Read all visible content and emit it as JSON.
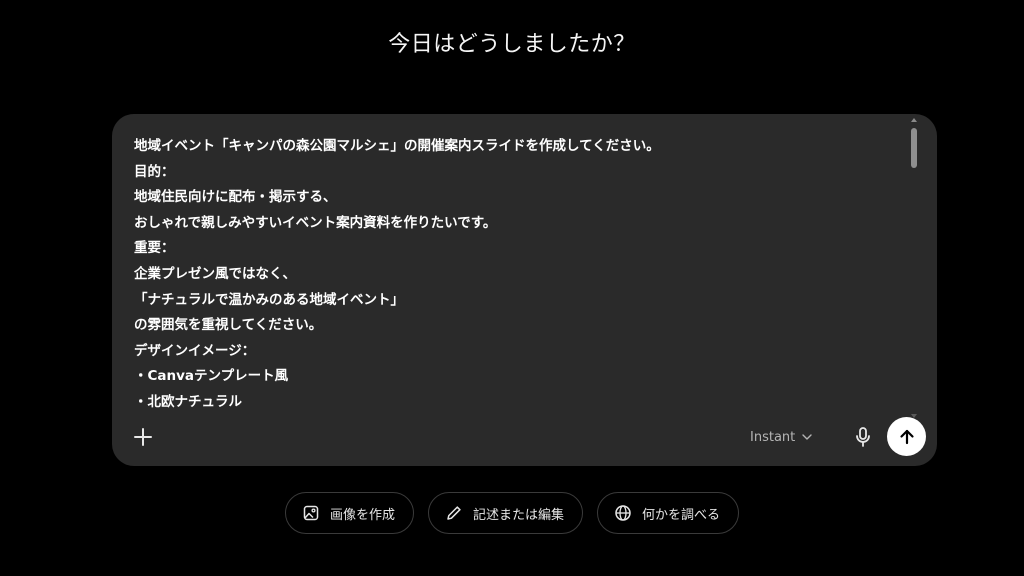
{
  "heading": "今日はどうしましたか？",
  "composer": {
    "prompt_lines": [
      "地域イベント「キャンパの森公園マルシェ」の開催案内スライドを作成してください。",
      "目的：",
      "地域住民向けに配布・掲示する、",
      "おしゃれで親しみやすいイベント案内資料を作りたいです。",
      "重要：",
      "企業プレゼン風ではなく、",
      "「ナチュラルで温かみのある地域イベント」",
      "の雰囲気を重視してください。",
      "デザインイメージ：",
      "・Canvaテンプレート風",
      "・北欧ナチュラル"
    ],
    "model_label": "Instant",
    "icons": {
      "attach": "plus-icon",
      "model": "chevron-down-icon",
      "mic": "microphone-icon",
      "send": "arrow-up-icon"
    }
  },
  "actions": [
    {
      "label": "画像を作成",
      "icon": "image-icon"
    },
    {
      "label": "記述または編集",
      "icon": "pencil-icon"
    },
    {
      "label": "何かを調べる",
      "icon": "globe-icon"
    }
  ],
  "colors": {
    "background": "#000000",
    "composer": "#2a2a2a",
    "send_button": "#ffffff"
  }
}
